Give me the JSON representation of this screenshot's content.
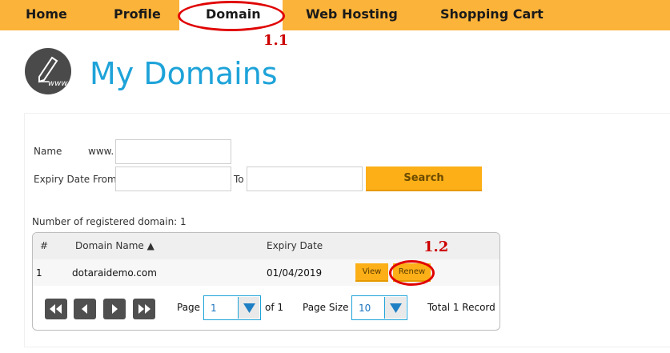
{
  "nav": {
    "items": [
      {
        "label": "Home"
      },
      {
        "label": "Profile"
      },
      {
        "label": "Domain"
      },
      {
        "label": "Web Hosting"
      },
      {
        "label": "Shopping Cart"
      }
    ],
    "accent_color": "#fbb33a"
  },
  "annotations": {
    "label_1": "1.1",
    "label_2": "1.2",
    "color": "#e00000"
  },
  "header": {
    "icon": "www-pen-icon",
    "icon_text": "www",
    "title": "My Domains",
    "title_color": "#1ea3d9"
  },
  "search": {
    "name_label": "Name",
    "prefix": "www.",
    "name_value": "",
    "expiry_from_label": "Expiry Date From",
    "expiry_from_value": "",
    "to_label": "To",
    "to_value": "",
    "search_label": "Search",
    "button_color": "#fcaf17"
  },
  "results": {
    "count_text": "Number of registered domain: 1",
    "columns": {
      "num": "#",
      "domain": "Domain Name ▲",
      "expiry": "Expiry Date"
    },
    "rows": [
      {
        "num": "1",
        "domain": "dotaraidemo.com",
        "expiry": "01/04/2019",
        "view_label": "View",
        "renew_label": "Renew"
      }
    ]
  },
  "pager": {
    "page_label": "Page",
    "page_value": "1",
    "of_text": "of 1",
    "page_size_label": "Page Size",
    "page_size_value": "10",
    "total_text": "Total 1 Record",
    "icons": [
      "first-page-icon",
      "prev-page-icon",
      "next-page-icon",
      "last-page-icon"
    ]
  }
}
